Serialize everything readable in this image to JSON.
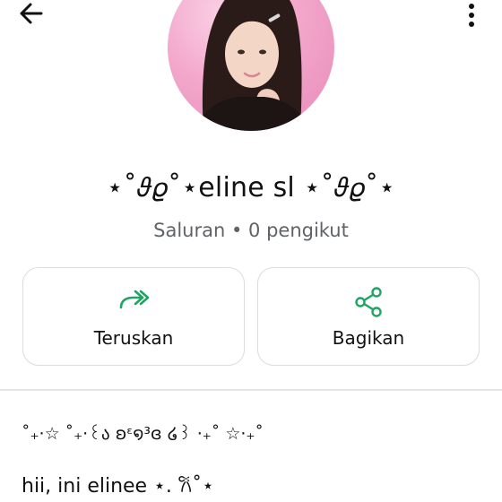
{
  "header": {
    "back_icon": "arrow-left-icon",
    "menu_icon": "more-vertical-icon"
  },
  "channel": {
    "name": "⋆˚𝜗𝜚˚⋆eline sl ⋆˚𝜗𝜚˚⋆",
    "meta": "Saluran • 0 pengikut"
  },
  "actions": [
    {
      "label": "Teruskan",
      "icon": "forward-double-arrow-icon"
    },
    {
      "label": "Bagikan",
      "icon": "share-icon"
    }
  ],
  "description": {
    "line1": "˚₊‧☆ ˚₊‧꒰ა ʚᵋ໑³ɞ ໒꒱ ‧₊˚ ☆‧₊˚",
    "line2": "hii, ini elinee ⋆. 𐙚˚⋆"
  },
  "colors": {
    "accent": "#1fa463",
    "text": "#111111",
    "secondary_text": "#5f6368",
    "card_border": "#dadce0"
  }
}
